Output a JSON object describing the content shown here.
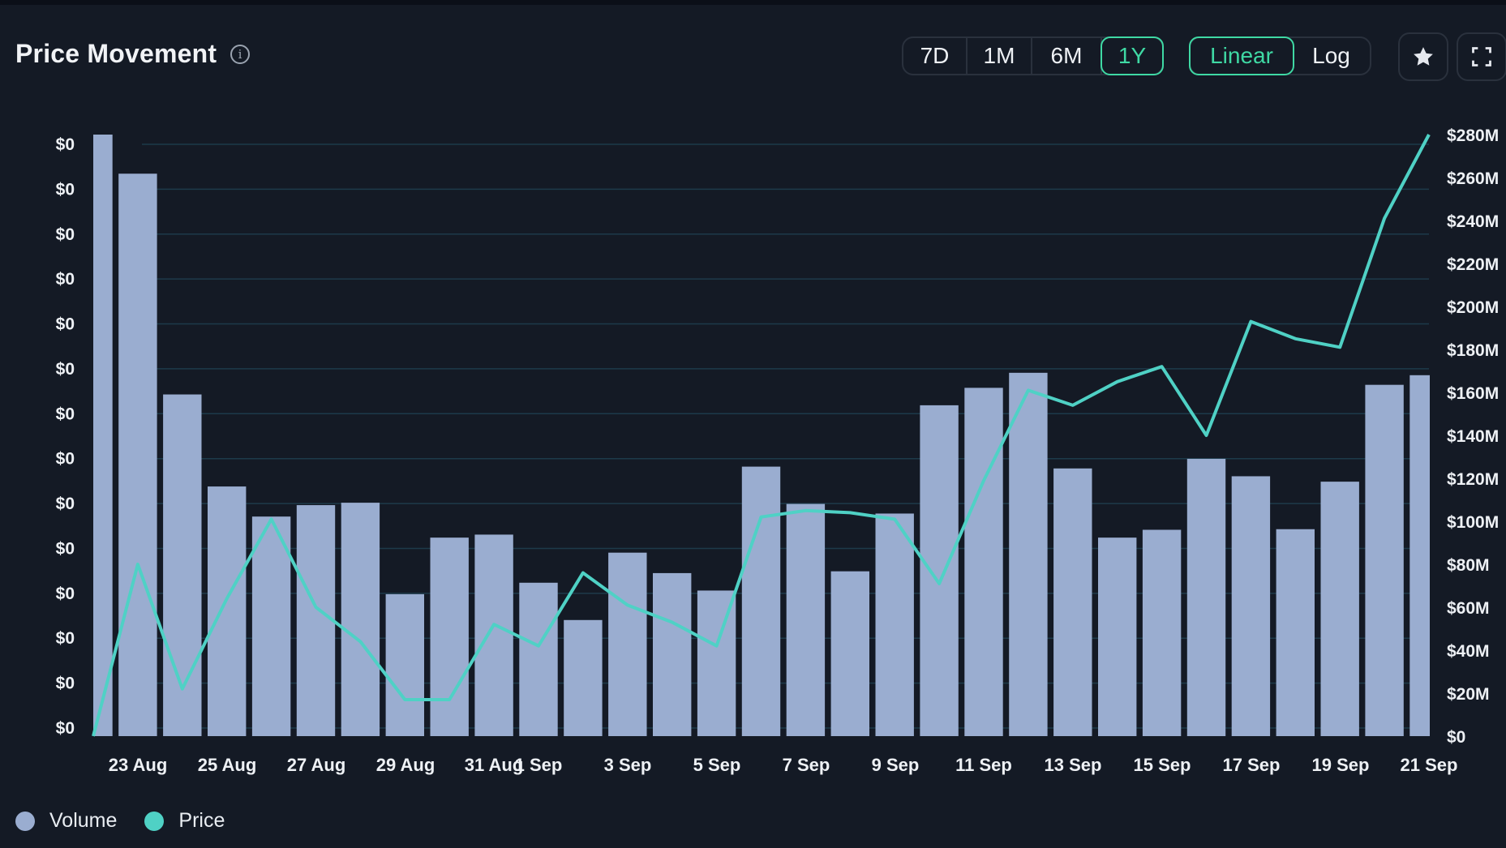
{
  "header": {
    "title": "Price Movement",
    "info_icon": "info-circle-icon",
    "range_buttons": [
      {
        "label": "7D",
        "active": false
      },
      {
        "label": "1M",
        "active": false
      },
      {
        "label": "6M",
        "active": false
      },
      {
        "label": "1Y",
        "active": true
      }
    ],
    "scale_buttons": [
      {
        "label": "Linear",
        "active": true
      },
      {
        "label": "Log",
        "active": false
      }
    ],
    "favorite_icon": "star-icon",
    "fullscreen_icon": "fullscreen-icon"
  },
  "colors": {
    "background": "#141a25",
    "volume": "#9aadd0",
    "price": "#4fd1c5",
    "accent": "#3fd9a4",
    "grid": "#1d3a4a"
  },
  "legend": [
    {
      "label": "Volume",
      "color": "#9aadd0"
    },
    {
      "label": "Price",
      "color": "#4fd1c5"
    }
  ],
  "chart_data": {
    "type": "bar+line",
    "title": "Price Movement",
    "x_tick_labels": [
      "23 Aug",
      "25 Aug",
      "27 Aug",
      "29 Aug",
      "31 Aug",
      "1 Sep",
      "3 Sep",
      "5 Sep",
      "7 Sep",
      "9 Sep",
      "11 Sep",
      "13 Sep",
      "15 Sep",
      "17 Sep",
      "19 Sep",
      "21 Sep"
    ],
    "left_axis": {
      "label": "Volume",
      "tick_labels": [
        "$0",
        "$0",
        "$0",
        "$0",
        "$0",
        "$0",
        "$0",
        "$0",
        "$0",
        "$0",
        "$0",
        "$0",
        "$0",
        "$0"
      ],
      "note": "volume tick labels all render as $0; volume values below are relative to the tallest bar (100)"
    },
    "right_axis": {
      "label": "Price",
      "tick_labels": [
        "$280M",
        "$260M",
        "$240M",
        "$220M",
        "$200M",
        "$180M",
        "$160M",
        "$140M",
        "$120M",
        "$100M",
        "$80M",
        "$60M",
        "$40M",
        "$20M",
        "$0"
      ],
      "ylim": [
        0,
        280
      ]
    },
    "grid": true,
    "legend_position": "bottom-left",
    "series": [
      {
        "name": "Volume",
        "type": "bar",
        "axis": "left",
        "unit": "relative (max = 100)",
        "values": [
          100,
          93.5,
          56.8,
          41.5,
          36.5,
          38.4,
          38.8,
          23.6,
          33.0,
          33.5,
          25.5,
          19.3,
          30.5,
          27.1,
          24.2,
          44.8,
          38.6,
          27.4,
          37.0,
          55.0,
          57.9,
          60.4,
          44.5,
          33.0,
          34.3,
          46.1,
          43.2,
          34.4,
          42.3,
          58.4,
          60.0
        ]
      },
      {
        "name": "Price",
        "type": "line",
        "axis": "right",
        "unit": "$M",
        "values": [
          0,
          80,
          22,
          64,
          101,
          60,
          44,
          17,
          17,
          52,
          42,
          76,
          61,
          53,
          42,
          102,
          105,
          104,
          101,
          71,
          119,
          161,
          154,
          165,
          172,
          140,
          193,
          185,
          181,
          241,
          280
        ]
      }
    ]
  }
}
